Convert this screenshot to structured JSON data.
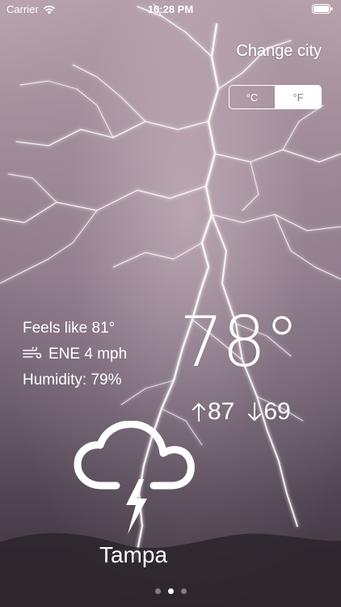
{
  "status_bar": {
    "carrier": "Carrier",
    "time": "10:28 PM"
  },
  "header": {
    "change_city_label": "Change city"
  },
  "unit_toggle": {
    "celsius_label": "°C",
    "fahrenheit_label": "°F",
    "selected": "°F"
  },
  "details": {
    "feels_like": "Feels like 81°",
    "wind": "ENE 4 mph",
    "humidity": "Humidity: 79%"
  },
  "temperature": {
    "current": "78°",
    "high": "87",
    "low": "69"
  },
  "condition": {
    "icon": "thunderstorm-icon"
  },
  "location": {
    "city": "Tampa"
  },
  "pager": {
    "count": 3,
    "active_index": 1
  },
  "colors": {
    "text": "#ffffff",
    "selected_segment_text": "#8a7582"
  }
}
